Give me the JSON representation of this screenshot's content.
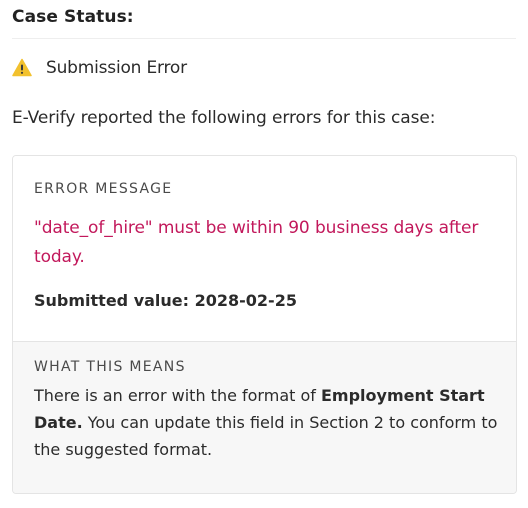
{
  "header": {
    "title": "Case Status:"
  },
  "status": {
    "icon": "warning-icon",
    "icon_color": "#f2c12e",
    "text": "Submission Error"
  },
  "intro": "E-Verify reported the following errors for this case:",
  "error_card": {
    "label": "ERROR MESSAGE",
    "message": "\"date_of_hire\" must be within 90 business days after today.",
    "message_color": "#c2185b",
    "submitted_value": "Submitted value: 2028-02-25"
  },
  "meaning": {
    "label": "WHAT THIS MEANS",
    "text_before": "There is an error with the format of ",
    "field_name": "Employment Start Date.",
    "text_after": " You can update this field in Section 2 to conform to the suggested format."
  }
}
